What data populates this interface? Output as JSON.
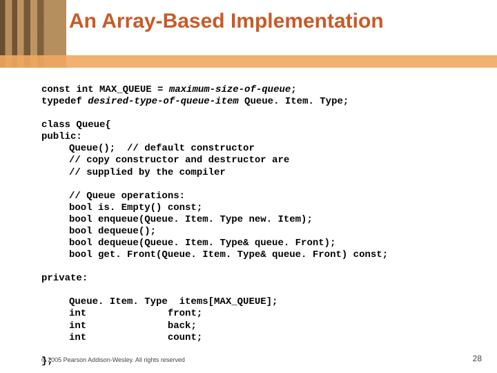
{
  "title": "An Array-Based Implementation",
  "code": {
    "l1a": "const int",
    "l1b": " MAX_QUEUE = ",
    "l1c": "maximum-size-of-queue",
    "l1d": ";",
    "l2a": "typedef ",
    "l2b": "desired-type-of-queue-item",
    "l2c": " Queue. Item. Type;",
    "l3": "class",
    "l3b": " Queue{",
    "l4": "public",
    "l4b": ":",
    "l5": "Queue();  // default constructor",
    "l6": "// copy constructor and destructor are",
    "l7": "// supplied by the compiler",
    "l8": "// Queue operations:",
    "l9a": "bool",
    "l9b": " is. Empty() ",
    "l9c": "const",
    "l9d": ";",
    "l10a": "bool",
    "l10b": " enqueue(Queue. Item. Type new. Item);",
    "l11a": "bool",
    "l11b": " dequeue();",
    "l12a": "bool",
    "l12b": " dequeue(Queue. Item. Type& queue. Front);",
    "l13a": "bool",
    "l13b": " get. Front(Queue. Item. Type& queue. Front) ",
    "l13c": "const",
    "l13d": ";",
    "l14": "private",
    "l14b": ":",
    "l15": "Queue. Item. Type  items[MAX_QUEUE];",
    "l16a": "int",
    "l16b": "              front;",
    "l17a": "int",
    "l17b": "              back;",
    "l18a": "int",
    "l18b": "              count;",
    "l19": "};"
  },
  "footer": "© 2005 Pearson Addison-Wesley. All rights reserved",
  "page": "28"
}
